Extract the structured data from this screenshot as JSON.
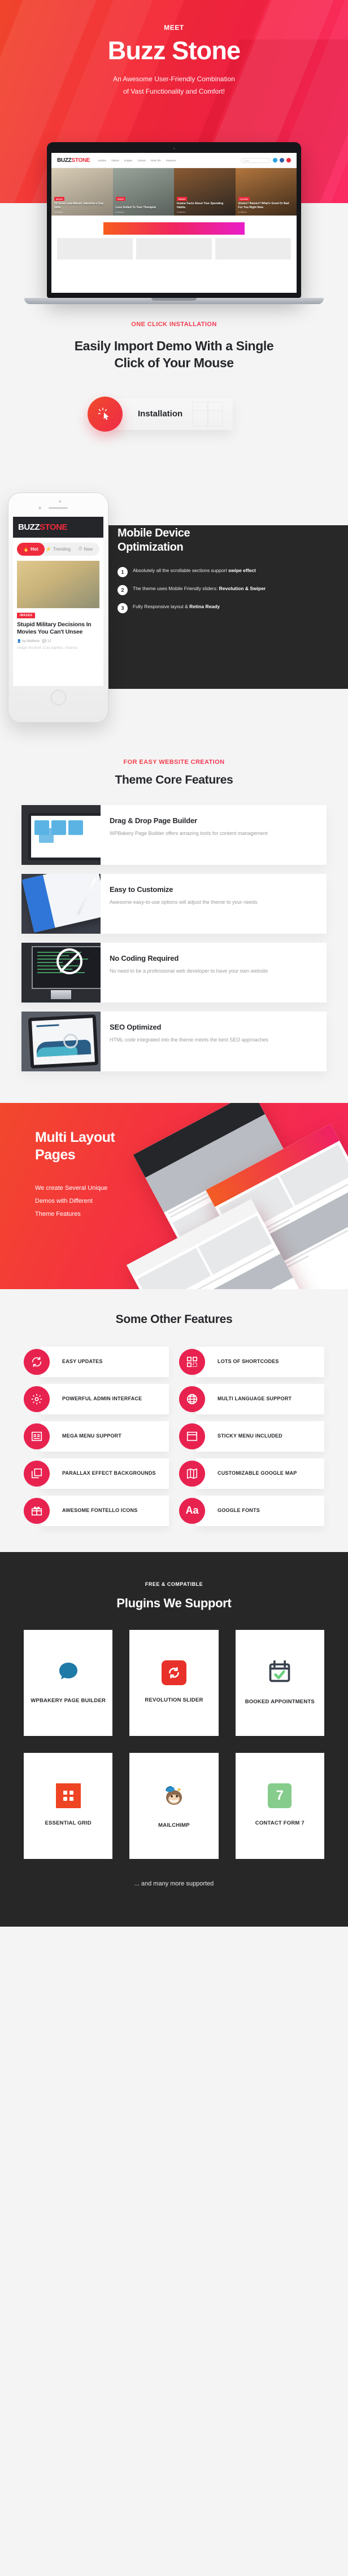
{
  "hero": {
    "eyebrow": "MEET",
    "title": "Buzz Stone",
    "subtitle_line1": "An Awesome User-Friendly Combination",
    "subtitle_line2": "of Vast Functionality  and Comfort!",
    "laptop_site": {
      "logo_part1": "BUZZ",
      "logo_part2": "STONE",
      "nav": [
        "Articles",
        "Videos",
        "Images",
        "Culture",
        "Real Life",
        "Features"
      ],
      "search_placeholder": "search...",
      "cards": [
        {
          "badge": "IMAGES",
          "title": "20 Great Last-Minute Valentine's Day Gifts",
          "meta": "by Matthew"
        },
        {
          "badge": "VIDEOS",
          "title": "Love Dolled To Your Therapist",
          "meta": "by Matthew"
        },
        {
          "badge": "IMAGES",
          "title": "Insane Facts About Your Spending Habits",
          "meta": "by Matthew"
        },
        {
          "badge": "CULTURE",
          "title": "Gluten? Ramen? What's Good Or Bad For You Right Now",
          "meta": "by Matthew"
        }
      ]
    }
  },
  "install": {
    "eyebrow": "ONE CLICK INSTALLATION",
    "title_line1": "Easily Import Demo With a Single",
    "title_line2": "Click of Your Mouse",
    "button_label": "Installation",
    "icon": "cursor-click-icon"
  },
  "mobile": {
    "title_line1": "Mobile Device",
    "title_line2": "Optimization",
    "items": [
      {
        "num": "1",
        "text_plain": "Absolutely all the scrollable sections support ",
        "text_bold": "swipe effect"
      },
      {
        "num": "2",
        "text_plain": "The theme uses Mobile Friendly sliders: ",
        "text_bold": "Revolution & Swiper"
      },
      {
        "num": "3",
        "text_plain": "Fully Responsive layout & ",
        "text_bold": "Retina Ready"
      }
    ],
    "phone_site": {
      "logo_part1": "BUZZ",
      "logo_part2": "STONE",
      "tabs": [
        {
          "label": "Hot",
          "icon": "flame-icon",
          "active": true
        },
        {
          "label": "Trending",
          "icon": "bolt-icon",
          "active": false
        },
        {
          "label": "New",
          "icon": "clock-icon",
          "active": false
        }
      ],
      "category": "IMAGES",
      "article_title": "Stupid Military Decisions In Movies You Can't Unsee",
      "author": "by Matthew",
      "comments": "12",
      "excerpt": "Integer tincidunt. Cras dapibus. Vivamus"
    }
  },
  "core": {
    "eyebrow": "FOR EASY WEBSITE CREATION",
    "title": "Theme Core Features",
    "features": [
      {
        "heading": "Drag & Drop Page Builder",
        "text": "WPBakery Page Builder offers amazing tools for content management",
        "image": "laptop-dragdrop-mock"
      },
      {
        "heading": "Easy to Customize",
        "text": "Awesome easy-to-use options will adjust the theme to your needs",
        "image": "tablet-stylus-mock"
      },
      {
        "heading": "No Coding Required",
        "text": "No need to be a professional web developer to have your own website",
        "image": "imac-nocode-mock"
      },
      {
        "heading": "SEO Optimized",
        "text": "HTML code integrated into the theme meets the best SEO approaches",
        "image": "tablet-seo-chart-mock"
      }
    ]
  },
  "multi": {
    "title_line1": "Multi Layout",
    "title_line2": "Pages",
    "text_line1": "We create Several Unique",
    "text_line2": "Demos with Different",
    "text_line3": "Theme Features"
  },
  "other": {
    "title": "Some Other Features",
    "items": [
      {
        "label": "EASY UPDATES",
        "icon": "refresh-icon"
      },
      {
        "label": "LOTS OF SHORTCODES",
        "icon": "grid-blocks-icon"
      },
      {
        "label": "POWERFUL ADMIN INTERFACE",
        "icon": "gear-icon"
      },
      {
        "label": "MULTI LANGUAGE SUPPORT",
        "icon": "globe-icon"
      },
      {
        "label": "MEGA MENU SUPPORT",
        "icon": "menu-panel-icon"
      },
      {
        "label": "STICKY MENU INCLUDED",
        "icon": "sticky-bar-icon"
      },
      {
        "label": "PARALLAX EFFECT BACKGROUNDS",
        "icon": "layers-icon"
      },
      {
        "label": "CUSTOMIZABLE GOOGLE MAP",
        "icon": "map-icon"
      },
      {
        "label": "AWESOME FONTELLO ICONS",
        "icon": "gift-icon"
      },
      {
        "label": "GOOGLE FONTS",
        "icon": "typography-aa-icon"
      }
    ]
  },
  "plugins": {
    "eyebrow": "FREE & COMPATIBLE",
    "title": "Plugins We Support",
    "items": [
      {
        "name": "WPBAKERY PAGE BUILDER",
        "icon": "wpbakery-logo-icon"
      },
      {
        "name": "REVOLUTION SLIDER",
        "icon": "revolution-slider-logo-icon"
      },
      {
        "name": "BOOKED APPOINTMENTS",
        "icon": "calendar-check-logo-icon"
      },
      {
        "name": "ESSENTIAL GRID",
        "icon": "essential-grid-logo-icon"
      },
      {
        "name": "MAILCHIMP",
        "icon": "mailchimp-monkey-logo-icon"
      },
      {
        "name": "CONTACT FORM 7",
        "icon": "contact-form-7-logo-icon"
      }
    ],
    "footer_note": "... and many more supported"
  },
  "colors": {
    "brand_red": "#ee2b3c",
    "brand_pink": "#e8224f",
    "dark": "#272727",
    "light_bg": "#f4f4f4"
  }
}
